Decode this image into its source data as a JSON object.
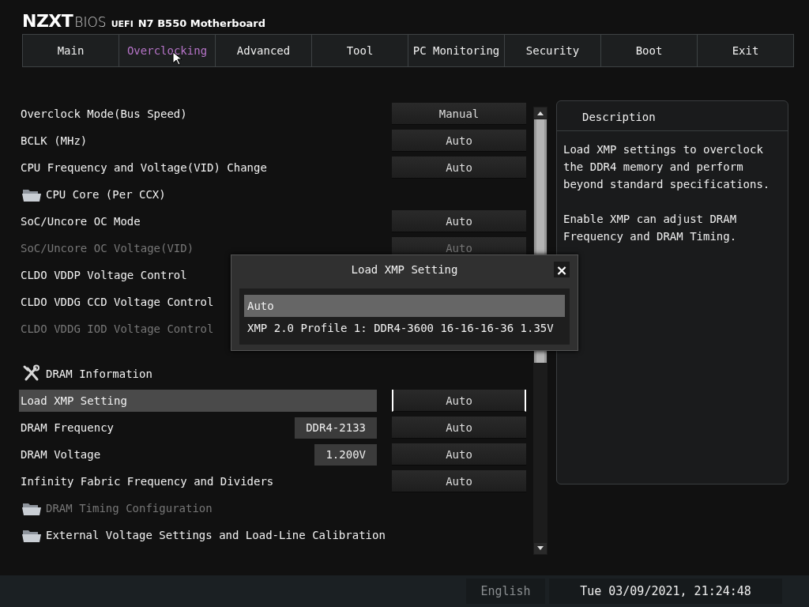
{
  "header": {
    "brand": "NZXT",
    "product": "BIOS",
    "mode": "UEFI",
    "board": "N7 B550 Motherboard"
  },
  "tabs": [
    {
      "label": "Main",
      "selected": false
    },
    {
      "label": "Overclocking",
      "selected": true
    },
    {
      "label": "Advanced",
      "selected": false
    },
    {
      "label": "Tool",
      "selected": false
    },
    {
      "label": "PC Monitoring",
      "selected": false
    },
    {
      "label": "Security",
      "selected": false
    },
    {
      "label": "Boot",
      "selected": false
    },
    {
      "label": "Exit",
      "selected": false
    }
  ],
  "rows": [
    {
      "kind": "setting",
      "label": "Overclock Mode(Bus Speed)",
      "value": "Manual",
      "disabled": false,
      "selected": false
    },
    {
      "kind": "setting",
      "label": "BCLK (MHz)",
      "value": "Auto",
      "disabled": false,
      "selected": false
    },
    {
      "kind": "setting",
      "label": "CPU Frequency and Voltage(VID) Change",
      "value": "Auto",
      "disabled": false,
      "selected": false
    },
    {
      "kind": "folder",
      "label": "CPU Core (Per CCX)",
      "disabled": false
    },
    {
      "kind": "setting",
      "label": "SoC/Uncore OC Mode",
      "value": "Auto",
      "disabled": false,
      "selected": false
    },
    {
      "kind": "setting",
      "label": "SoC/Uncore OC Voltage(VID)",
      "value": "Auto",
      "disabled": true,
      "selected": false
    },
    {
      "kind": "setting",
      "label": "CLDO VDDP Voltage Control",
      "disabled": false,
      "selected": false
    },
    {
      "kind": "setting",
      "label": "CLDO VDDG CCD Voltage Control",
      "disabled": false,
      "selected": false
    },
    {
      "kind": "setting",
      "label": "CLDO VDDG IOD Voltage Control",
      "disabled": true,
      "selected": false
    },
    {
      "kind": "section",
      "label": "DRAM Information"
    },
    {
      "kind": "setting",
      "label": "Load XMP Setting",
      "value": "Auto",
      "disabled": false,
      "selected": true
    },
    {
      "kind": "setting",
      "label": "DRAM Frequency",
      "info": "DDR4-2133",
      "value": "Auto",
      "disabled": false,
      "selected": false
    },
    {
      "kind": "setting",
      "label": "DRAM Voltage",
      "info": "1.200V",
      "value": "Auto",
      "disabled": false,
      "selected": false
    },
    {
      "kind": "setting",
      "label": "Infinity Fabric Frequency and Dividers",
      "value": "Auto",
      "disabled": false,
      "selected": false
    },
    {
      "kind": "folder",
      "label": "DRAM Timing Configuration",
      "disabled": true
    },
    {
      "kind": "folder",
      "label": "External Voltage Settings and Load-Line Calibration",
      "disabled": false
    }
  ],
  "description": {
    "title": "Description",
    "paragraphs": [
      "Load XMP settings to overclock the DDR4 memory and perform beyond standard specifications.",
      "Enable XMP can adjust DRAM Frequency and DRAM Timing."
    ]
  },
  "dialog": {
    "title": "Load XMP Setting",
    "close": "×",
    "options": [
      {
        "label": "Auto",
        "selected": true
      },
      {
        "label": "XMP 2.0 Profile 1: DDR4-3600 16-16-16-36 1.35V",
        "selected": false
      }
    ]
  },
  "status_bar": {
    "language": "English",
    "datetime": "Tue 03/09/2021, 21:24:48"
  }
}
